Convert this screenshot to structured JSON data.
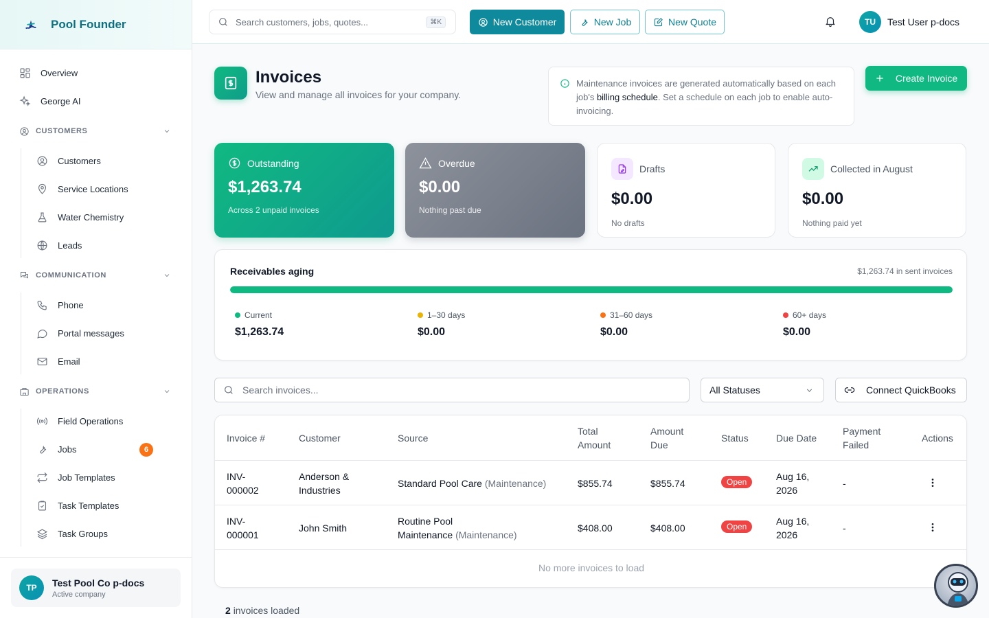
{
  "brand": {
    "name": "Pool Founder"
  },
  "sidebar": {
    "top_items": [
      {
        "label": "Overview",
        "icon": "grid-icon"
      },
      {
        "label": "George AI",
        "icon": "sparkles-icon"
      }
    ],
    "sections": [
      {
        "title": "CUSTOMERS",
        "items": [
          "Customers",
          "Service Locations",
          "Water Chemistry",
          "Leads"
        ]
      },
      {
        "title": "COMMUNICATION",
        "items": [
          "Phone",
          "Portal messages",
          "Email"
        ]
      },
      {
        "title": "OPERATIONS",
        "items": [
          "Field Operations",
          "Jobs",
          "Job Templates",
          "Task Templates",
          "Task Groups"
        ]
      }
    ],
    "jobs_badge": "6",
    "company": {
      "initials": "TP",
      "name": "Test Pool Co p-docs",
      "status": "Active company"
    }
  },
  "topbar": {
    "search_placeholder": "Search customers, jobs, quotes...",
    "shortcut": "⌘K",
    "new_customer": "New Customer",
    "new_job": "New Job",
    "new_quote": "New Quote",
    "user_initials": "TU",
    "user_name": "Test User p-docs"
  },
  "header": {
    "title": "Invoices",
    "subtitle": "View and manage all invoices for your company.",
    "info_pre": "Maintenance invoices are generated automatically based on each job's ",
    "info_link": "billing schedule",
    "info_post": ". Set a schedule on each job to enable auto-invoicing.",
    "create_label": "Create Invoice"
  },
  "stats": [
    {
      "label": "Outstanding",
      "value": "$1,263.74",
      "sub": "Across 2 unpaid invoices"
    },
    {
      "label": "Overdue",
      "value": "$0.00",
      "sub": "Nothing past due"
    },
    {
      "label": "Drafts",
      "value": "$0.00",
      "sub": "No drafts"
    },
    {
      "label": "Collected in August",
      "value": "$0.00",
      "sub": "Nothing paid yet"
    }
  ],
  "aging": {
    "title": "Receivables aging",
    "total": "$1,263.74 in sent invoices",
    "current_fraction": 1.0,
    "buckets": [
      {
        "label": "Current",
        "value": "$1,263.74",
        "color": "#10b981"
      },
      {
        "label": "1–30 days",
        "value": "$0.00",
        "color": "#eab308"
      },
      {
        "label": "31–60 days",
        "value": "$0.00",
        "color": "#f97316"
      },
      {
        "label": "60+ days",
        "value": "$0.00",
        "color": "#ef4444"
      }
    ]
  },
  "filters": {
    "search_placeholder": "Search invoices...",
    "status_value": "All Statuses",
    "quickbooks": "Connect QuickBooks"
  },
  "table": {
    "headers": {
      "invoice": "Invoice #",
      "customer": "Customer",
      "source": "Source",
      "total_1": "Total",
      "total_2": "Amount",
      "due_1": "Amount",
      "due_2": "Due",
      "status": "Status",
      "due_date": "Due Date",
      "failed_1": "Payment",
      "failed_2": "Failed",
      "actions": "Actions"
    },
    "rows": [
      {
        "inv_1": "INV-",
        "inv_2": "000002",
        "cust_1": "Anderson &",
        "cust_2": "Industries",
        "src_1": "Standard Pool Care",
        "src_tag_1": "(Maintenance)",
        "src_2": "",
        "total": "$855.74",
        "due": "$855.74",
        "status": "Open",
        "date_1": "Aug 16,",
        "date_2": "2026",
        "failed": "-"
      },
      {
        "inv_1": "INV-",
        "inv_2": "000001",
        "cust_1": "John Smith",
        "cust_2": "",
        "src_1": "Routine Pool",
        "src_tag_1": "",
        "src_2": "Maintenance",
        "src_tag_2": "(Maintenance)",
        "total": "$408.00",
        "due": "$408.00",
        "status": "Open",
        "date_1": "Aug 16,",
        "date_2": "2026",
        "failed": "-"
      }
    ],
    "end_text": "No more invoices to load",
    "loaded_count": "2",
    "loaded_text": "invoices loaded"
  },
  "colors": {
    "accent": "#0f8a9c",
    "success": "#10b981",
    "danger": "#ef4444",
    "warning": "#f97316"
  }
}
